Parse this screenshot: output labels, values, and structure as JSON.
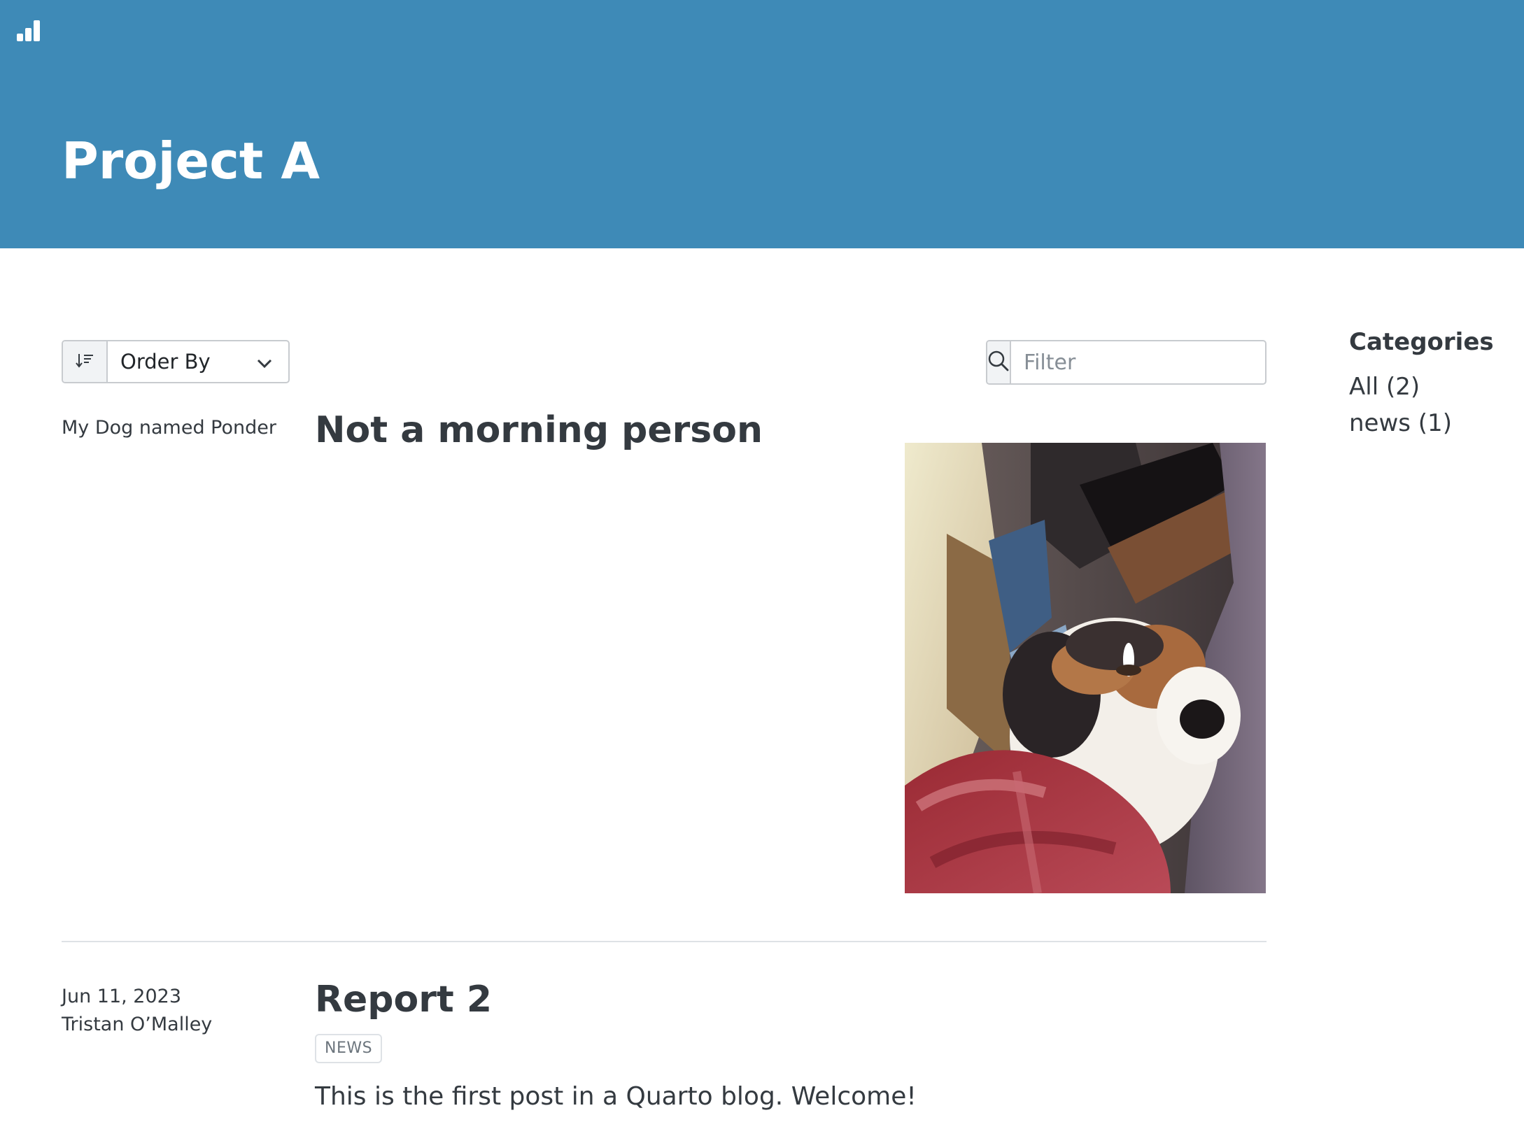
{
  "site": {
    "logo_icon": "bar-chart-icon",
    "banner_color": "#3e8ab7"
  },
  "page": {
    "title": "Project A"
  },
  "controls": {
    "sort_icon": "sort-down-icon",
    "order_by_label": "Order By",
    "chevron_icon": "chevron-down-icon",
    "search_icon": "search-icon",
    "filter_placeholder": "Filter",
    "filter_value": ""
  },
  "categories": {
    "heading": "Categories",
    "items": [
      {
        "label": "All (2)"
      },
      {
        "label": "news (1)"
      }
    ]
  },
  "posts": [
    {
      "meta_lines": [
        "My Dog named Ponder"
      ],
      "title": "Not a morning person",
      "image": "photo of a sleepy dog lying on a red plaid blanket"
    },
    {
      "meta_lines": [
        "Jun 11, 2023",
        "Tristan O’Malley"
      ],
      "title": "Report 2",
      "category": "NEWS",
      "description": "This is the first post in a Quarto blog. Welcome!"
    }
  ]
}
